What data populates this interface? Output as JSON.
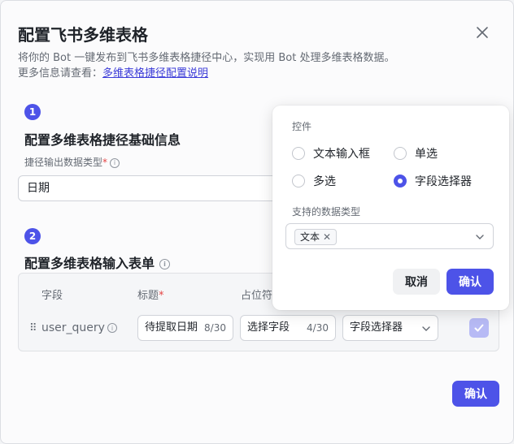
{
  "modal": {
    "title": "配置飞书多维表格",
    "description": "将你的 Bot 一键发布到飞书多维表格捷径中心，实现用 Bot 处理多维表格数据。",
    "more_info_prefix": "更多信息请查看：",
    "more_info_link": "多维表格捷径配置说明",
    "close_icon": "close-icon",
    "confirm_label": "确认"
  },
  "section1": {
    "step": "1",
    "title": "配置多维表格捷径基础信息",
    "field_label": "捷径输出数据类型",
    "required_mark": "*",
    "field_value": "日期"
  },
  "section2": {
    "step": "2",
    "title": "配置多维表格输入表单",
    "columns": [
      "字段",
      "标题",
      "占位符"
    ],
    "required_mark": "*",
    "row": {
      "field": "user_query",
      "title_value": "待提取日期",
      "title_count": "8/30",
      "placeholder_value": "选择字段",
      "placeholder_count": "4/30",
      "control_value": "字段选择器",
      "checked": true
    }
  },
  "popover": {
    "control_label": "控件",
    "options": [
      {
        "label": "文本输入框",
        "selected": false
      },
      {
        "label": "单选",
        "selected": false
      },
      {
        "label": "多选",
        "selected": false
      },
      {
        "label": "字段选择器",
        "selected": true
      }
    ],
    "types_label": "支持的数据类型",
    "selected_type": "文本",
    "cancel_label": "取消",
    "ok_label": "确认"
  },
  "colors": {
    "accent": "#4d53e8",
    "required": "#e54545",
    "link": "#3b3bd8"
  }
}
